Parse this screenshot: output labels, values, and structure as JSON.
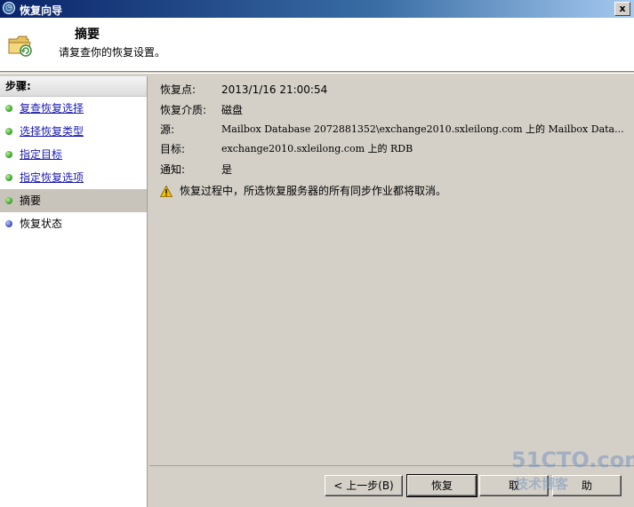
{
  "window": {
    "title": "恢复向导",
    "close_glyph": "x"
  },
  "header": {
    "title": "摘要",
    "subtitle": "请复查你的恢复设置。",
    "icon": "folder-restore-icon"
  },
  "sidebar": {
    "heading": "步骤:",
    "items": [
      {
        "label": "复查恢复选择",
        "state": "done"
      },
      {
        "label": "选择恢复类型",
        "state": "done"
      },
      {
        "label": "指定目标",
        "state": "done"
      },
      {
        "label": "指定恢复选项",
        "state": "done"
      },
      {
        "label": "摘要",
        "state": "current"
      },
      {
        "label": "恢复状态",
        "state": "pending"
      }
    ]
  },
  "summary": {
    "recovery_point_label": "恢复点:",
    "recovery_point_value": "2013/1/16 21:00:54",
    "media_label": "恢复介质:",
    "media_value": "磁盘",
    "source_label": "源:",
    "source_value": "Mailbox Database 2072881352\\exchange2010.sxleilong.com 上的 Mailbox Data...",
    "target_label": "目标:",
    "target_value": "exchange2010.sxleilong.com 上的 RDB",
    "notify_label": "通知:",
    "notify_value": "是",
    "warning": "恢复过程中，所选恢复服务器的所有同步作业都将取消。"
  },
  "buttons": {
    "back": "< 上一步(B)",
    "restore": "恢复",
    "cancel": "取",
    "help": "助"
  },
  "watermark": {
    "line1": "51CTO.com",
    "line2": "技术博客"
  },
  "colors": {
    "title_bar": "#0a246a",
    "link": "#1a1ab0",
    "done_dot": "#2f9a1e",
    "pending_dot": "#3a46b8",
    "warning": "#f0c000"
  }
}
